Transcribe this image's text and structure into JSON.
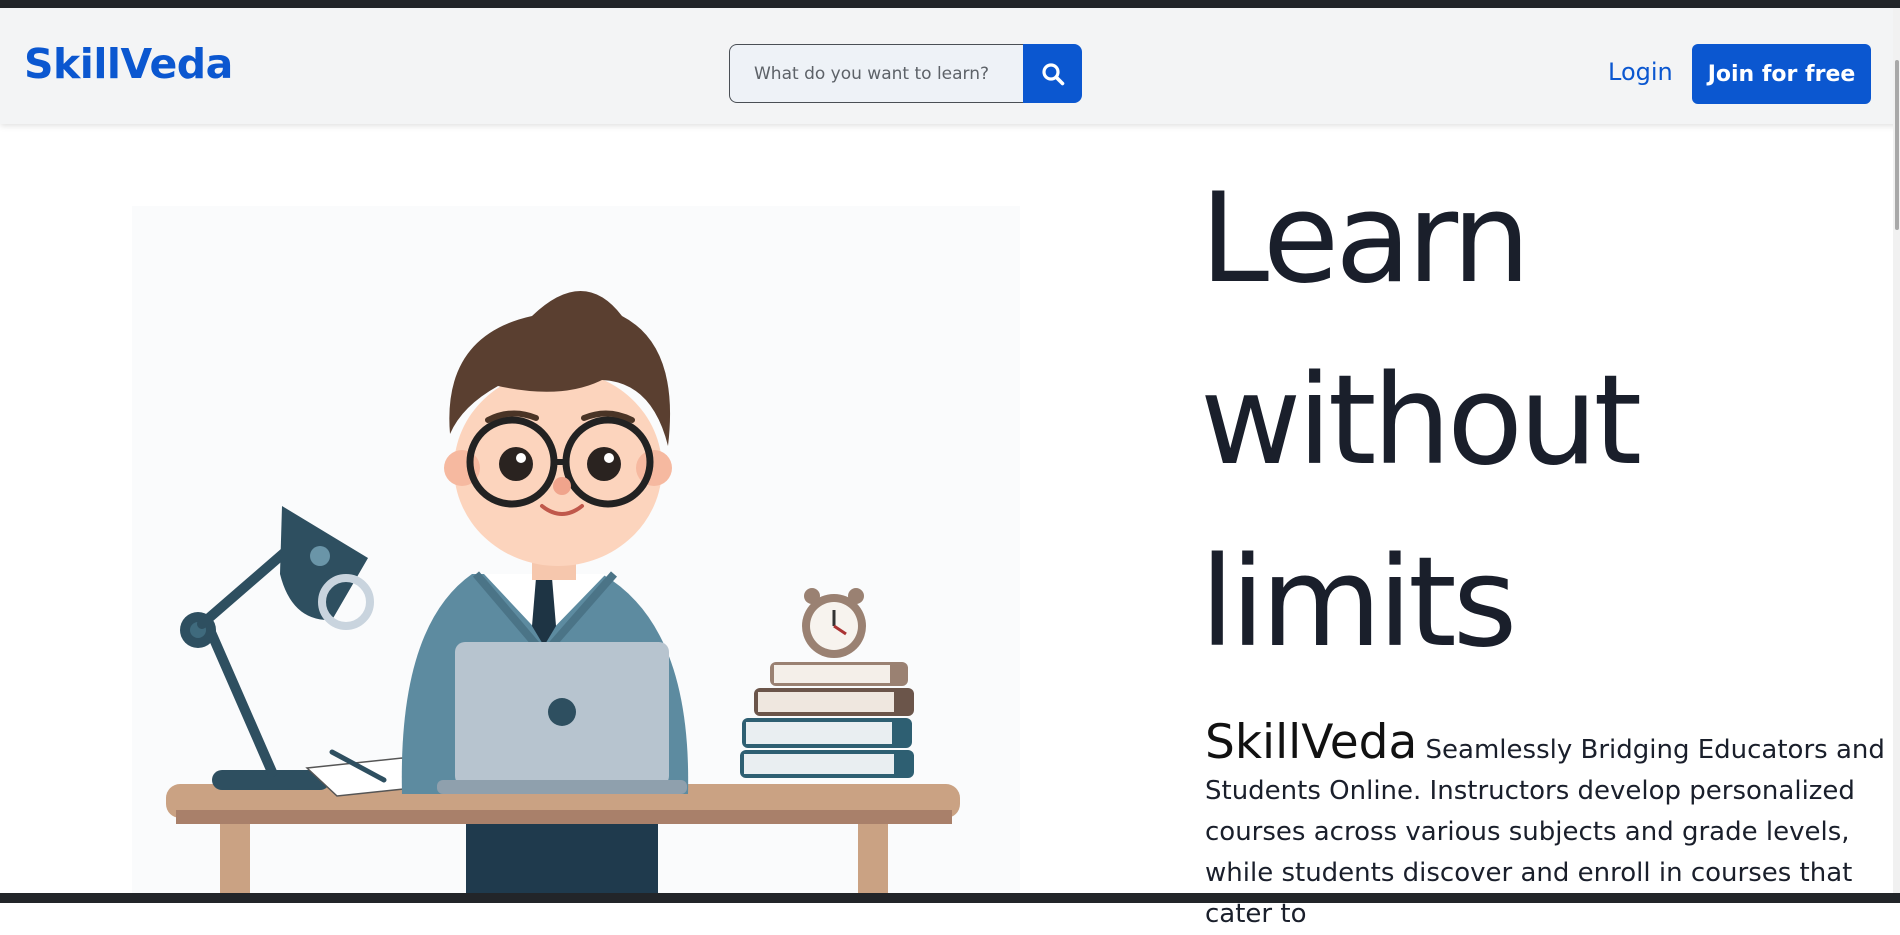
{
  "header": {
    "brand": "SkillVeda",
    "search": {
      "placeholder": "What do you want to learn?",
      "value": ""
    },
    "search_button_icon": "search-icon",
    "login_label": "Login",
    "join_label": "Join for free"
  },
  "hero": {
    "title_lines": [
      "Learn",
      "without",
      "limits"
    ],
    "description_brand": "SkillVeda",
    "description_text": " Seamlessly Bridging Educators and Students Online. Instructors develop personalized courses across various subjects and grade levels, while students discover and enroll in courses that cater to",
    "illustration": "student-at-desk-illustration"
  },
  "colors": {
    "accent": "#0b57d0",
    "heading": "#1a1f2b",
    "navbar_bg": "#f3f4f5"
  }
}
